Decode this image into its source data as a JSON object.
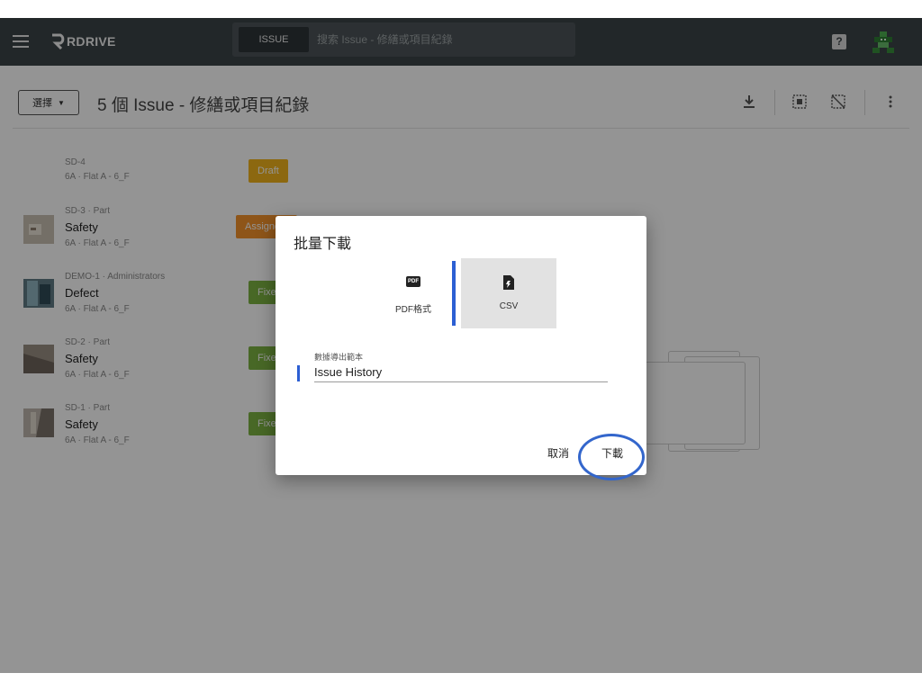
{
  "app": {
    "logo_text": "RDRIVE"
  },
  "search": {
    "type_label": "ISSUE",
    "placeholder": "搜索 Issue - 修繕或項目紀錄"
  },
  "help": {
    "label": "?"
  },
  "toolbar": {
    "select_label": "選擇",
    "page_title": "5 個 Issue - 修繕或項目紀錄"
  },
  "issues": [
    {
      "id": "SD-4",
      "title": "",
      "location": "6A · Flat A - 6_F",
      "status": "Draft",
      "status_color": "#f2b41c"
    },
    {
      "id": "SD-3 · Part",
      "title": "Safety",
      "location": "6A · Flat A - 6_F",
      "status": "Assigned",
      "status_color": "#f4932b"
    },
    {
      "id": "DEMO-1 · Administrators",
      "title": "Defect",
      "location": "6A · Flat A - 6_F",
      "status": "Fixed",
      "status_color": "#7cb342"
    },
    {
      "id": "SD-2 · Part",
      "title": "Safety",
      "location": "6A · Flat A - 6_F",
      "status": "Fixed",
      "status_color": "#7cb342"
    },
    {
      "id": "SD-1 · Part",
      "title": "Safety",
      "location": "6A · Flat A - 6_F",
      "status": "Fixed",
      "status_color": "#7cb342"
    }
  ],
  "dialog": {
    "title": "批量下載",
    "formats": [
      {
        "icon_text": "PDF",
        "label": "PDF格式"
      },
      {
        "label": "CSV"
      }
    ],
    "template_label": "數據導出範本",
    "template_value": "Issue History",
    "cancel_label": "取消",
    "download_label": "下載"
  },
  "colors": {
    "appbar": "#3c4448",
    "accent": "#2c5fd3",
    "highlight": "#3366cc"
  }
}
